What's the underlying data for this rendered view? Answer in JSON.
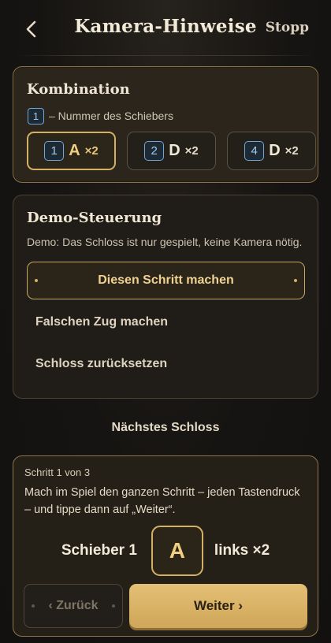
{
  "header": {
    "title": "Kamera-Hinweise",
    "stop_label": "Stopp"
  },
  "combination": {
    "title": "Kombination",
    "legend_number": "1",
    "legend_text": "– Nummer des Schiebers",
    "items": [
      {
        "number": "1",
        "letter": "A",
        "mult": "×2",
        "active": true
      },
      {
        "number": "2",
        "letter": "D",
        "mult": "×2",
        "active": false
      },
      {
        "number": "4",
        "letter": "D",
        "mult": "×2",
        "active": false
      }
    ]
  },
  "demo": {
    "title": "Demo-Steuerung",
    "note": "Demo: Das Schloss ist nur gespielt, keine Kamera nötig.",
    "primary_label": "Diesen Schritt machen",
    "wrong_label": "Falschen Zug machen",
    "reset_label": "Schloss zurücksetzen"
  },
  "next_lock_label": "Nächstes Schloss",
  "step": {
    "counter": "Schritt 1 von 3",
    "text": "Mach im Spiel den ganzen Schritt – jeden Tastendruck – und tippe dann auf „Weiter“.",
    "prefix": "Schieber 1",
    "key": "A",
    "suffix": "links ×2",
    "back_label": "‹ Zurück",
    "next_label": "Weiter ›"
  },
  "colors": {
    "accent": "#d4b065",
    "badge_blue": "#6fa8d8",
    "background": "#161412"
  }
}
